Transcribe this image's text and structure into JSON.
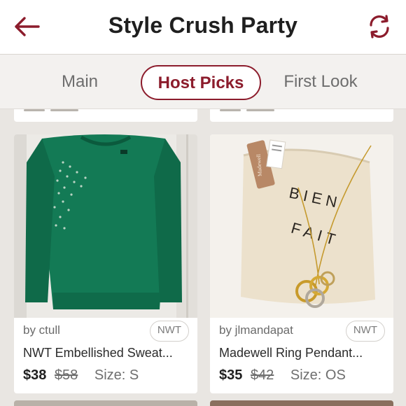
{
  "header": {
    "title": "Style Crush Party",
    "back_icon": "back-arrow-icon",
    "refresh_icon": "refresh-icon",
    "accent_color": "#8c1c2c"
  },
  "tabs": [
    {
      "label": "Main",
      "active": false
    },
    {
      "label": "Host Picks",
      "active": true
    },
    {
      "label": "First Look",
      "active": false
    }
  ],
  "listings": [
    {
      "seller": "by ctull",
      "badge": "NWT",
      "title": "NWT Embellished Sweat...",
      "price": "$38",
      "original_price": "$58",
      "size": "Size: S",
      "image": "green-embellished-sweater-photo"
    },
    {
      "seller": "by jlmandapat",
      "badge": "NWT",
      "title": "Madewell Ring Pendant...",
      "price": "$35",
      "original_price": "$42",
      "size": "Size: OS",
      "image": "ring-pendant-necklace-photo"
    }
  ],
  "necklace_pouch_text": [
    "BIEN",
    "FAIT"
  ]
}
